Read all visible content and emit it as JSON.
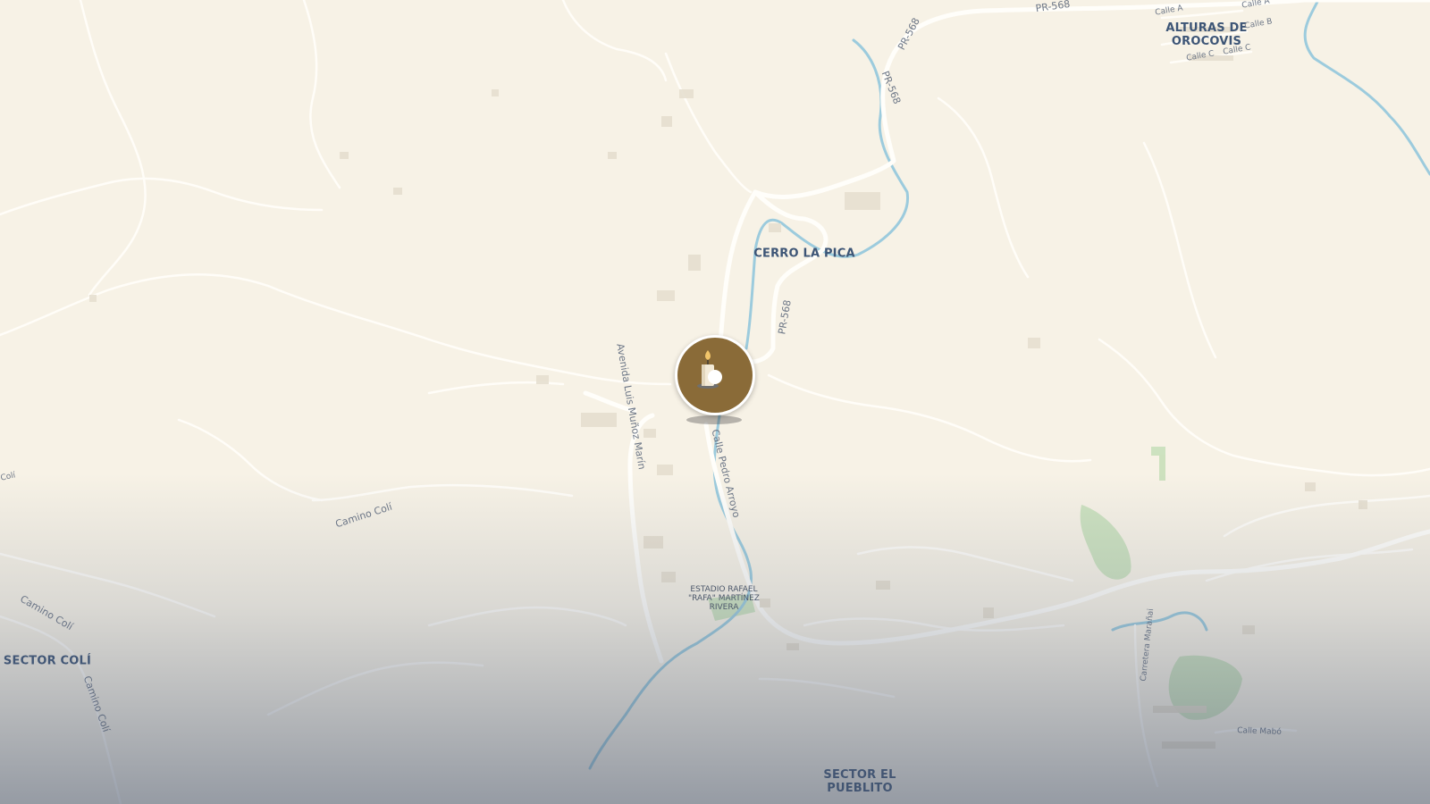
{
  "map": {
    "place_labels": {
      "alturas_de_orocovis": [
        "ALTURAS DE",
        "OROCOVIS"
      ],
      "cerro_la_pica": "CERRO LA PICA",
      "sector_coli": "SECTOR COLÍ",
      "sector_el_pueblito": [
        "SECTOR EL",
        "PUEBLITO"
      ]
    },
    "poi_labels": {
      "estadio": [
        "ESTADIO RAFAEL",
        "\"RAFA\" MARTÍNEZ",
        "RIVERA"
      ]
    },
    "road_labels": {
      "pr568_top": "PR-568",
      "pr568_upper": "PR-568",
      "pr568_diag": "PR-568",
      "pr568_mid": "PR-568",
      "avenida_luis_munoz_marin": "Avenida Luis Muñoz Marín",
      "calle_pedro_arroyo": "Calle Pedro Arroyo",
      "camino_coli_1": "Camino Colí",
      "camino_coli_2": "Camino Colí",
      "camino_coli_3": "Camino Colí",
      "coli_edge": "Colí",
      "calle_a_1": "Calle A",
      "calle_a_2": "Calle A",
      "calle_b": "Calle B",
      "calle_c_1": "Calle C",
      "calle_c_2": "Calle C",
      "carretera_maranai": "Carretera Marañai",
      "calle_mabo": "Calle Mabó"
    },
    "marker": {
      "icon": "candle-icon",
      "color": "#8a6b38"
    },
    "colors": {
      "land": "#f7f2e6",
      "roads": "#fffdf8",
      "water": "#8fc6dc",
      "parks": "#b9d9ae",
      "labels": "#3d5576"
    }
  }
}
